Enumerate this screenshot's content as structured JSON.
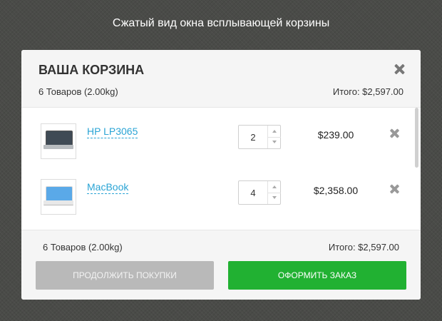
{
  "caption": "Сжатый вид окна всплывающей корзины",
  "cart": {
    "title": "ВАША КОРЗИНА",
    "close_icon": "close-icon",
    "summary": "6 Товаров  (2.00kg)",
    "total": "Итого: $2,597.00"
  },
  "items": [
    {
      "name": "HP LP3065",
      "quantity": "2",
      "price": "$239.00",
      "thumbnail": "laptop-hp-image"
    },
    {
      "name": "MacBook",
      "quantity": "4",
      "price": "$2,358.00",
      "thumbnail": "laptop-macbook-image"
    }
  ],
  "footer": {
    "summary": "6 Товаров  (2.00kg)",
    "total": "Итого: $2,597.00",
    "continue_label": "ПРОДОЛЖИТЬ ПОКУПКИ",
    "checkout_label": "ОФОРМИТЬ ЗАКАЗ"
  },
  "colors": {
    "accent_link": "#2aa4d5",
    "checkout_button": "#21b132",
    "continue_button": "#b9b9b9",
    "backdrop": "#4a4b48"
  }
}
